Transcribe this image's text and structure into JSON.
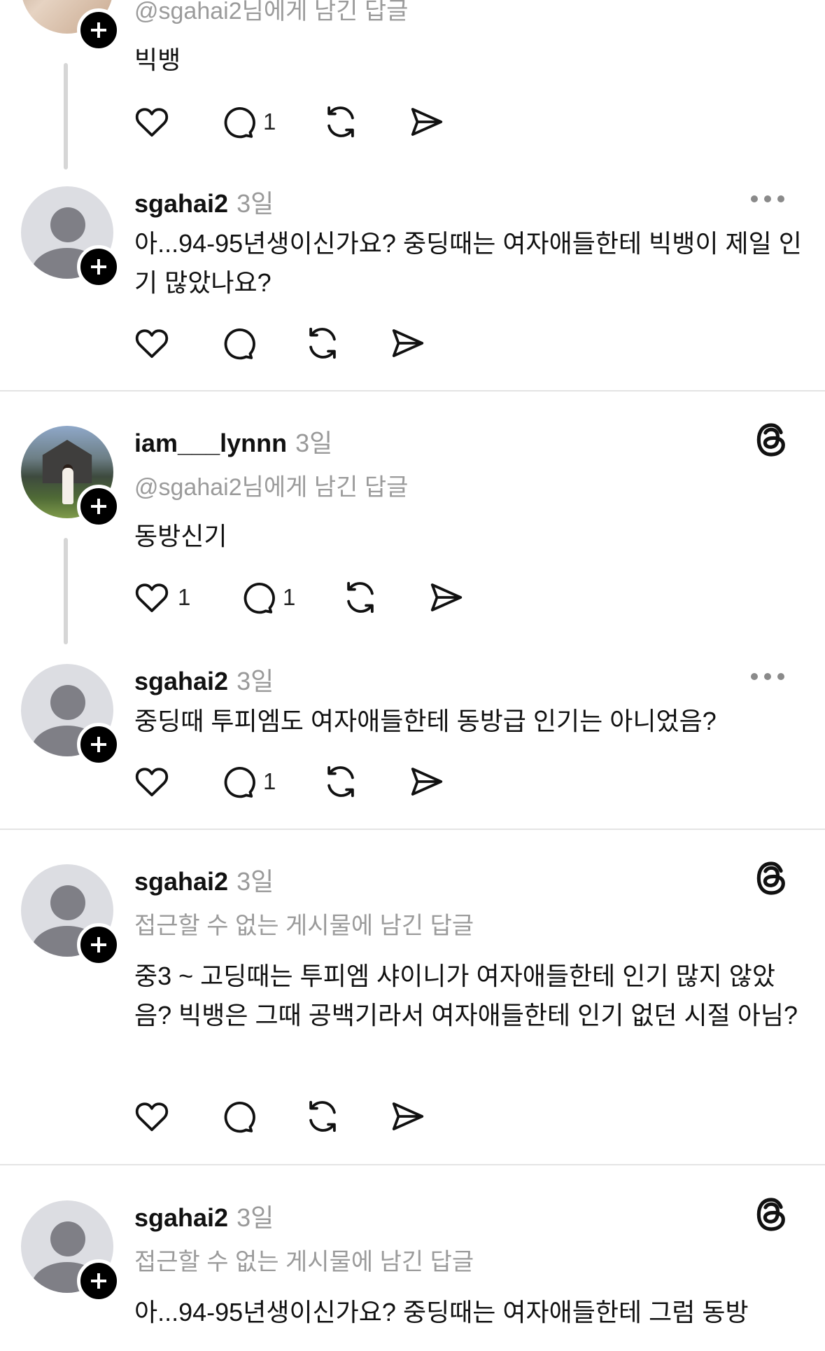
{
  "post0": {
    "partial_subline": "@sgahai2님에게 남긴 답글",
    "text": "빅뱅",
    "comments": "1"
  },
  "post1": {
    "username": "sgahai2",
    "time": "3일",
    "text": "아...94-95년생이신가요? 중딩때는 여자애들한테 빅뱅이 제일 인기 많았나요?"
  },
  "post2": {
    "username": "iam___lynnn",
    "time": "3일",
    "subline": "@sgahai2님에게 남긴 답글",
    "text": "동방신기",
    "likes": "1",
    "comments": "1"
  },
  "post3": {
    "username": "sgahai2",
    "time": "3일",
    "text": "중딩때 투피엠도 여자애들한테 동방급 인기는 아니었음?",
    "comments": "1"
  },
  "post4": {
    "username": "sgahai2",
    "time": "3일",
    "subline": "접근할 수 없는 게시물에 남긴 답글",
    "text": "중3 ~ 고딩때는 투피엠 샤이니가 여자애들한테 인기 많지 않았음? 빅뱅은 그때 공백기라서 여자애들한테 인기 없던 시절 아님?"
  },
  "post5": {
    "username": "sgahai2",
    "time": "3일",
    "subline": "접근할 수 없는 게시물에 남긴 답글",
    "text": "아...94-95년생이신가요? 중딩때는 여자애들한테 그럼 동방"
  },
  "icons": {
    "like": "heart-icon",
    "comment": "comment-bubble-icon",
    "repost": "repost-icon",
    "share": "send-icon",
    "more": "more-dots-icon",
    "threads": "threads-logo-icon",
    "follow": "plus-icon"
  },
  "colors": {
    "background": "#ffffff",
    "text": "#111111",
    "secondary": "#9b9b9b",
    "divider": "#e4e4e4",
    "avatar_default": "#dcdde2"
  }
}
